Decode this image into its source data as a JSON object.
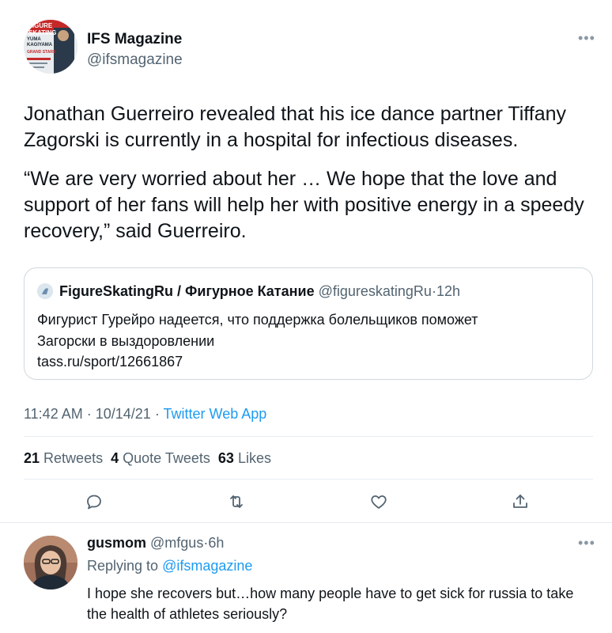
{
  "tweet": {
    "author_name": "IFS Magazine",
    "author_handle": "@ifsmagazine",
    "text_p1": "Jonathan Guerreiro revealed that his ice dance partner Tiffany Zagorski is currently in a hospital for infectious diseases.",
    "text_p2": "“We are very worried about her … We hope that the love and support of her fans will help her with positive energy in a speedy recovery,” said Guerreiro.",
    "avatar_cover_text": "FIGURE SKATING",
    "avatar_cover_name": "YUMA KAGIYAMA",
    "avatar_cover_sub": "GRAND STARS",
    "more_icon": "ellipsis-icon"
  },
  "quote": {
    "author_name": "FigureSkatingRu / Фигурное Катание",
    "author_handle": "@figureskatingRu",
    "separator": "·",
    "time": "12h",
    "line1": "Фигурист Гурейро надеется, что поддержка болельщиков поможет",
    "line2": "Загорски в выздоровлении",
    "link": "tass.ru/sport/12661867"
  },
  "meta": {
    "time": "11:42 AM",
    "sep1": "·",
    "date": "10/14/21",
    "sep2": "·",
    "source": "Twitter Web App"
  },
  "stats": {
    "retweets_count": "21",
    "retweets_label": "Retweets",
    "quotes_count": "4",
    "quotes_label": "Quote Tweets",
    "likes_count": "63",
    "likes_label": "Likes"
  },
  "actions": [
    "reply-icon",
    "retweet-icon",
    "like-icon",
    "share-icon"
  ],
  "reply": {
    "author_name": "gusmom",
    "author_handle": "@mfgus",
    "separator": "·",
    "time": "6h",
    "replying_label": "Replying to",
    "replying_handle": "@ifsmagazine",
    "text": "I hope she recovers but…how many people have to get sick for russia to take the health of athletes seriously?"
  },
  "colors": {
    "accent": "#1d9bf0",
    "text": "#0f1419",
    "secondary": "#536471",
    "border": "#cfd9de"
  }
}
